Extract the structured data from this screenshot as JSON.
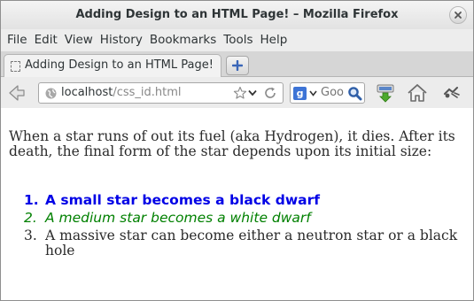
{
  "window": {
    "title": "Adding Design to an HTML Page! – Mozilla Firefox"
  },
  "menu": [
    "File",
    "Edit",
    "View",
    "History",
    "Bookmarks",
    "Tools",
    "Help"
  ],
  "tab": {
    "label": "Adding Design to an HTML Page!"
  },
  "navbar": {
    "url_host": "localhost",
    "url_path": "/css_id.html",
    "search_placeholder": "Goo",
    "search_engine_letter": "g"
  },
  "content": {
    "paragraph": "When a star runs of out its fuel (aka Hydrogen), it dies. After its death, the final form of the star depends upon its initial size:",
    "list": [
      {
        "number": "1.",
        "text": "A small star becomes a black dwarf"
      },
      {
        "number": "2.",
        "text": "A medium star becomes a white dwarf"
      },
      {
        "number": "3.",
        "text": "A massive star can become either a neutron star or a black hole"
      }
    ]
  },
  "colors": {
    "item_1": "#0000e6",
    "item_2": "#008000",
    "item_3": "#2b2b2b"
  },
  "icons": [
    "close-icon",
    "plus-icon",
    "back-arrow-icon",
    "globe-icon",
    "star-icon",
    "chevron-down-icon",
    "reload-icon",
    "google-icon",
    "search-icon",
    "download-icon",
    "home-icon",
    "extension-icon"
  ]
}
